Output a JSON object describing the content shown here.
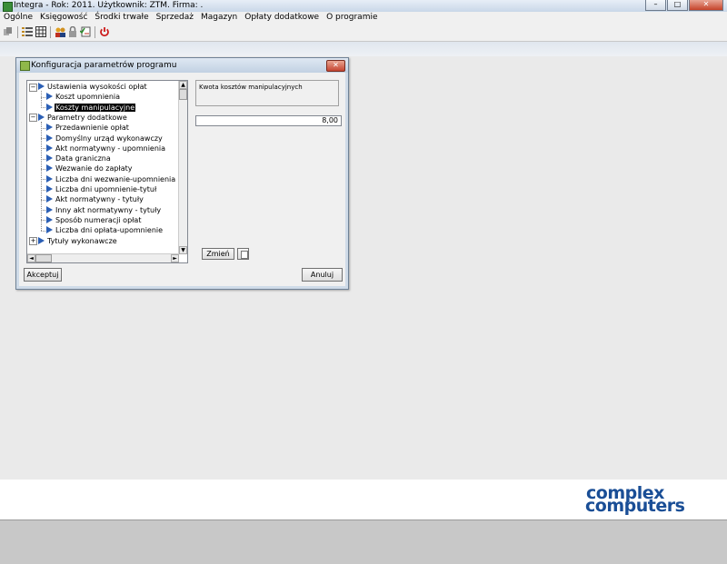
{
  "window": {
    "title": "Integra -  Rok: 2011. Użytkownik: ZTM. Firma: ."
  },
  "menubar": [
    "Ogólne",
    "Księgowość",
    "Środki trwałe",
    "Sprzedaż",
    "Magazyn",
    "Opłaty dodatkowe",
    "O programie"
  ],
  "toolbar_icons": [
    "copy-icon",
    "list-icon",
    "grid-icon",
    "users-icon",
    "lock-icon",
    "checklist-icon",
    "power-icon"
  ],
  "dialog": {
    "title": "Konfiguracja parametrów programu",
    "tree": [
      {
        "label": "Ustawienia wysokości opłat",
        "level": 0,
        "expanded": true
      },
      {
        "label": "Koszt upomnienia",
        "level": 1
      },
      {
        "label": "Koszty manipulacyjne",
        "level": 1,
        "selected": true
      },
      {
        "label": "Parametry dodatkowe",
        "level": 0,
        "expanded": true
      },
      {
        "label": "Przedawnienie opłat",
        "level": 1
      },
      {
        "label": "Domyślny urząd wykonawczy",
        "level": 1
      },
      {
        "label": "Akt normatywny - upomnienia",
        "level": 1
      },
      {
        "label": "Data graniczna",
        "level": 1
      },
      {
        "label": "Wezwanie do zapłaty",
        "level": 1
      },
      {
        "label": "Liczba dni wezwanie-upomnienia",
        "level": 1
      },
      {
        "label": "Liczba dni upomnienie-tytuł",
        "level": 1
      },
      {
        "label": "Akt normatywny - tytuły",
        "level": 1
      },
      {
        "label": "Inny akt normatywny - tytuły",
        "level": 1
      },
      {
        "label": "Sposób numeracji opłat",
        "level": 1
      },
      {
        "label": "Liczba dni opłata-upomnienie",
        "level": 1
      },
      {
        "label": "Tytuły wykonawcze",
        "level": 0,
        "expanded": false
      }
    ],
    "description": "Kwota kosztów manipulacyjnych",
    "value": "8,00",
    "change_button": "Zmień",
    "accept_button": "Akceptuj",
    "cancel_button": "Anuluj"
  },
  "logo": {
    "line1": "complex",
    "line2": "computers",
    "color": "#1a4e96"
  }
}
